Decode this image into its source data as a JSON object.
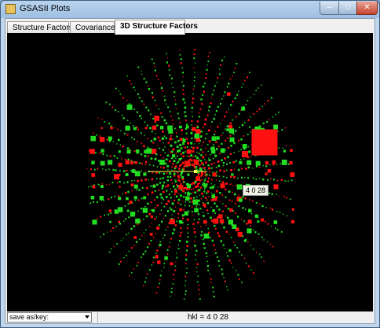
{
  "window": {
    "title": "GSASII Plots",
    "minimize_glyph": "–",
    "maximize_glyph": "□",
    "close_glyph": "✕"
  },
  "tabs": [
    {
      "label": "Structure Factors",
      "active": false
    },
    {
      "label": "Covariance",
      "active": false
    },
    {
      "label": "3D Structure Factors",
      "active": true
    }
  ],
  "plot": {
    "background": "#000000",
    "colors": {
      "positive": "#22dd22",
      "negative": "#ff1111",
      "highlight": "#ffff55"
    },
    "tooltip": "4 0 28"
  },
  "statusbar": {
    "save_combo": "save as/key:",
    "status_text": "hkl = 4 0 28"
  }
}
